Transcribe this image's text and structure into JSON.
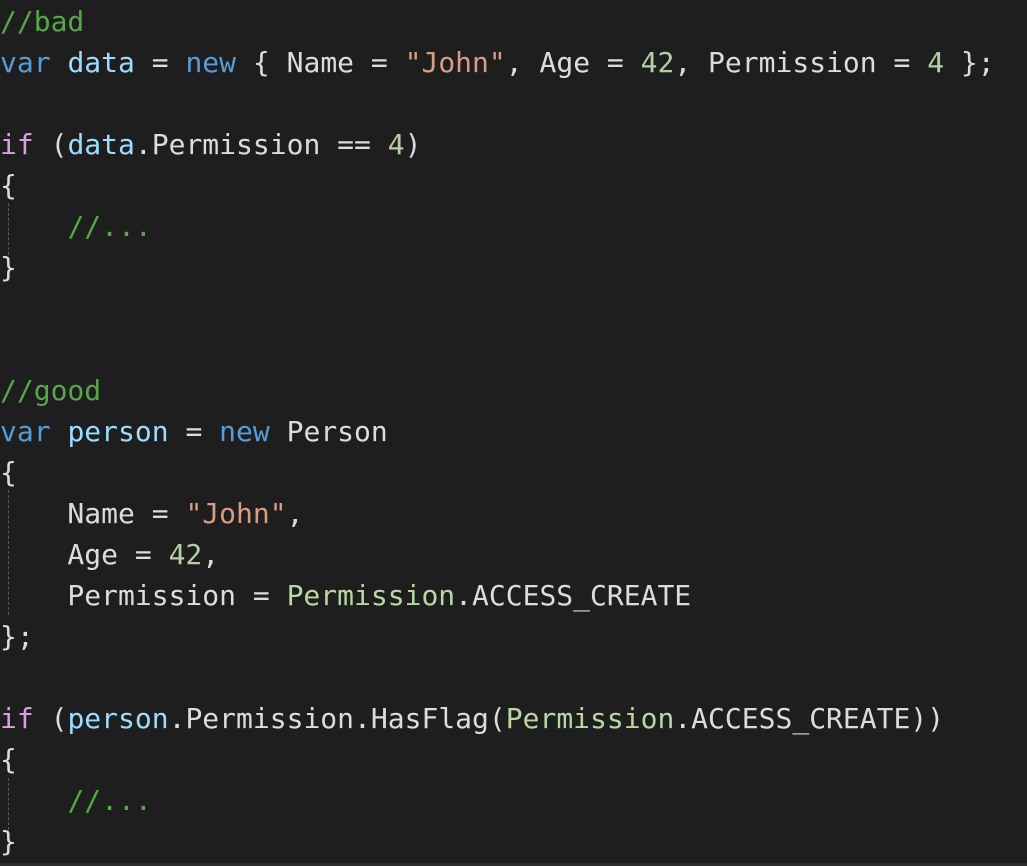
{
  "editor": {
    "lines": [
      [
        {
          "t": "//bad",
          "c": "cmt"
        }
      ],
      [
        {
          "t": "var",
          "c": "kw"
        },
        {
          "t": " ",
          "c": "plain"
        },
        {
          "t": "data",
          "c": "var"
        },
        {
          "t": " = ",
          "c": "plain"
        },
        {
          "t": "new",
          "c": "kw"
        },
        {
          "t": " { Name = ",
          "c": "plain"
        },
        {
          "t": "\"John\"",
          "c": "str"
        },
        {
          "t": ", Age = ",
          "c": "plain"
        },
        {
          "t": "42",
          "c": "num"
        },
        {
          "t": ", Permission = ",
          "c": "plain"
        },
        {
          "t": "4",
          "c": "num"
        },
        {
          "t": " };",
          "c": "plain"
        }
      ],
      [],
      [
        {
          "t": "if",
          "c": "ctl"
        },
        {
          "t": " (",
          "c": "plain"
        },
        {
          "t": "data",
          "c": "var"
        },
        {
          "t": ".Permission == ",
          "c": "plain"
        },
        {
          "t": "4",
          "c": "num"
        },
        {
          "t": ")",
          "c": "plain"
        }
      ],
      [
        {
          "t": "{",
          "c": "plain"
        }
      ],
      [
        {
          "t": "    ",
          "c": "plain"
        },
        {
          "t": "//...",
          "c": "cmt"
        }
      ],
      [
        {
          "t": "}",
          "c": "plain"
        }
      ],
      [],
      [],
      [
        {
          "t": "//good",
          "c": "cmt"
        }
      ],
      [
        {
          "t": "var",
          "c": "kw"
        },
        {
          "t": " ",
          "c": "plain"
        },
        {
          "t": "person",
          "c": "var"
        },
        {
          "t": " = ",
          "c": "plain"
        },
        {
          "t": "new",
          "c": "kw"
        },
        {
          "t": " Person",
          "c": "plain"
        }
      ],
      [
        {
          "t": "{",
          "c": "plain"
        }
      ],
      [
        {
          "t": "    Name = ",
          "c": "plain"
        },
        {
          "t": "\"John\"",
          "c": "str"
        },
        {
          "t": ",",
          "c": "plain"
        }
      ],
      [
        {
          "t": "    Age = ",
          "c": "plain"
        },
        {
          "t": "42",
          "c": "num"
        },
        {
          "t": ",",
          "c": "plain"
        }
      ],
      [
        {
          "t": "    Permission = ",
          "c": "plain"
        },
        {
          "t": "Permission",
          "c": "type"
        },
        {
          "t": ".ACCESS_CREATE",
          "c": "plain"
        }
      ],
      [
        {
          "t": "};",
          "c": "plain"
        }
      ],
      [],
      [
        {
          "t": "if",
          "c": "ctl"
        },
        {
          "t": " (",
          "c": "plain"
        },
        {
          "t": "person",
          "c": "var"
        },
        {
          "t": ".Permission.HasFlag(",
          "c": "plain"
        },
        {
          "t": "Permission",
          "c": "type"
        },
        {
          "t": ".ACCESS_CREATE))",
          "c": "plain"
        }
      ],
      [
        {
          "t": "{",
          "c": "plain"
        }
      ],
      [
        {
          "t": "    ",
          "c": "plain"
        },
        {
          "t": "//...",
          "c": "cmt"
        }
      ],
      [
        {
          "t": "}",
          "c": "plain"
        }
      ]
    ]
  }
}
